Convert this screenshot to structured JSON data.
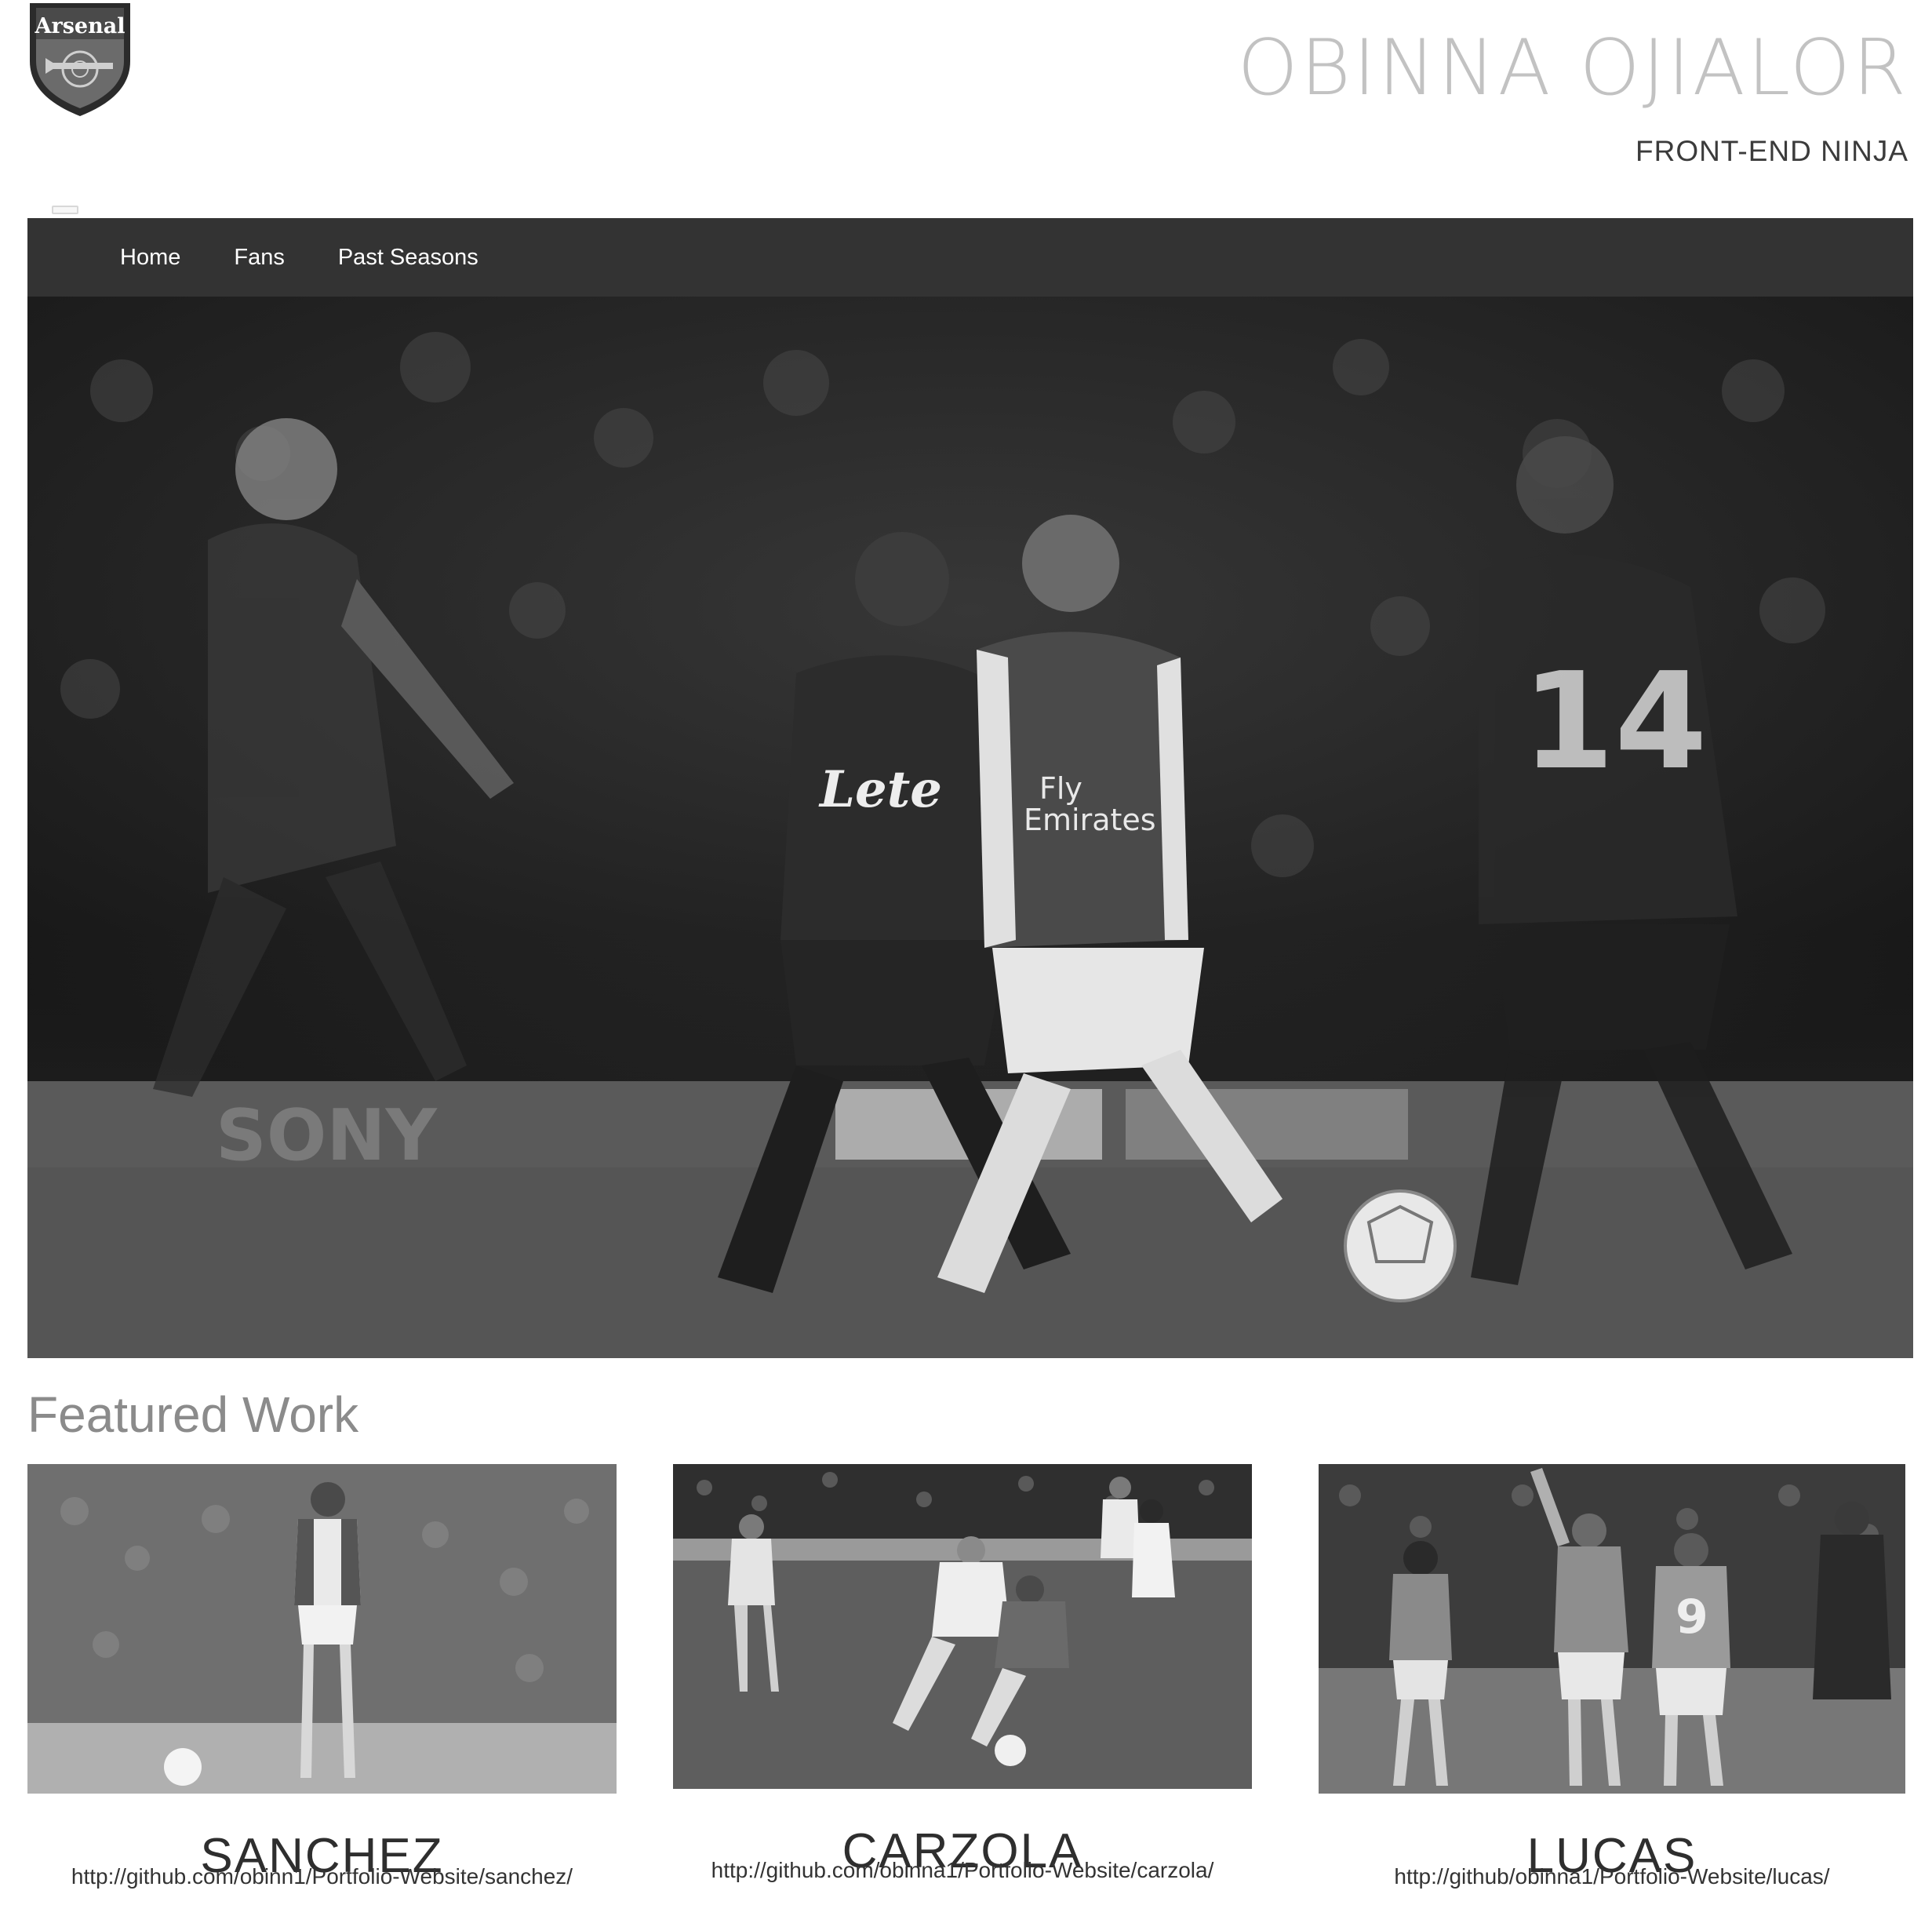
{
  "header": {
    "logo_text": "Arsenal",
    "name": "OBINNA OJIALOR",
    "tagline": "FRONT-END NINJA"
  },
  "nav": {
    "items": [
      {
        "label": "Home"
      },
      {
        "label": "Fans"
      },
      {
        "label": "Past Seasons"
      }
    ]
  },
  "hero": {
    "image_description": "black-and-white football match photo"
  },
  "featured": {
    "title": "Featured Work",
    "cards": [
      {
        "title": "SANCHEZ",
        "link": "http://github.com/obinn1/Portfolio-Website/sanchez/"
      },
      {
        "title": "CARZOLA",
        "link": "http://github.com/obinna1/Portfolio-Website/carzola/"
      },
      {
        "title": "LUCAS",
        "link": "http://github/obinna1/Portfolio-Website/lucas/"
      }
    ]
  },
  "colors": {
    "navbar": "#333333",
    "name_text": "#c2c2c2",
    "heading_gray": "#8b8b8b"
  }
}
